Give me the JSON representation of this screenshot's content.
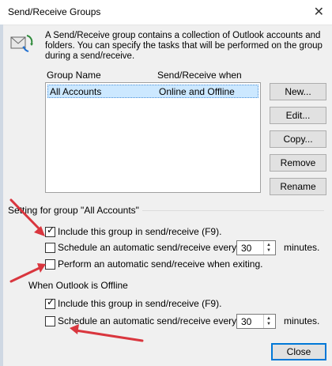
{
  "window": {
    "title": "Send/Receive Groups",
    "close_glyph": "✕"
  },
  "description": "A Send/Receive group contains a collection of Outlook accounts and folders. You can specify the tasks that will be performed on the group during a send/receive.",
  "list": {
    "headers": [
      "Group Name",
      "Send/Receive when"
    ],
    "rows": [
      {
        "name": "All Accounts",
        "when": "Online and Offline"
      }
    ]
  },
  "buttons": {
    "new": "New...",
    "edit": "Edit...",
    "copy": "Copy...",
    "remove": "Remove",
    "rename": "Rename",
    "close": "Close"
  },
  "group_setting": {
    "label": "Setting for group \"All Accounts\"",
    "include": {
      "label": "Include this group in send/receive (F9).",
      "checked": true
    },
    "schedule": {
      "label": "Schedule an automatic send/receive every",
      "value": "30",
      "unit": "minutes.",
      "checked": false
    },
    "exit": {
      "label": "Perform an automatic send/receive when exiting.",
      "checked": false
    }
  },
  "offline": {
    "label": "When Outlook is Offline",
    "include": {
      "label": "Include this group in send/receive (F9).",
      "checked": true
    },
    "schedule": {
      "label": "Schedule an automatic send/receive every",
      "value": "30",
      "unit": "minutes.",
      "checked": false
    }
  },
  "icons": {
    "app": "send-receive-icon",
    "check": "✓",
    "spin_up": "▲",
    "spin_down": "▼"
  },
  "colors": {
    "annotation_arrow": "#d9363e",
    "selection": "#cce8ff",
    "accent": "#0078d7"
  }
}
